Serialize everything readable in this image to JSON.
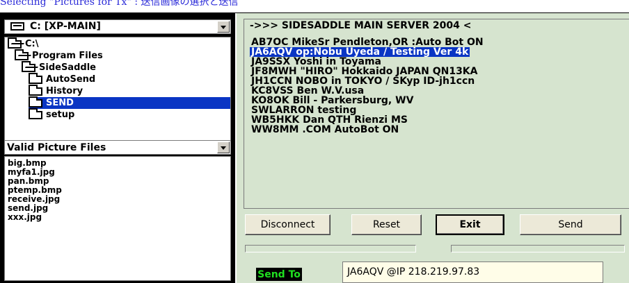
{
  "caption": "Selecting \"Pictures for Tx\"    :  送信画像の選択と送信",
  "drive": {
    "label": "C: [XP-MAIN]"
  },
  "tree": {
    "items": [
      {
        "label": "C:\\",
        "depth": 0,
        "icon": "folder-open-icon",
        "selected": false
      },
      {
        "label": "Program Files",
        "depth": 1,
        "icon": "folder-open-icon",
        "selected": false
      },
      {
        "label": "SideSaddle",
        "depth": 2,
        "icon": "folder-open-icon",
        "selected": false
      },
      {
        "label": "AutoSend",
        "depth": 3,
        "icon": "folder-icon",
        "selected": false
      },
      {
        "label": "History",
        "depth": 3,
        "icon": "folder-icon",
        "selected": false
      },
      {
        "label": "SEND",
        "depth": 3,
        "icon": "folder-icon",
        "selected": true
      },
      {
        "label": "setup",
        "depth": 3,
        "icon": "folder-icon",
        "selected": false
      }
    ]
  },
  "filter": {
    "label": "Valid Picture Files"
  },
  "files": [
    "big.bmp",
    "myfa1.jpg",
    "pan.bmp",
    "ptemp.bmp",
    "receive.jpg",
    "send.jpg",
    "xxx.jpg"
  ],
  "server": {
    "header": "->>>   SIDESADDLE MAIN SERVER 2004  <",
    "rows": [
      {
        "text": "AB7OC MikeSr  Pendleton,OR :Auto Bot ON",
        "selected": false
      },
      {
        "text": "JA6AQV op:Nobu Uyeda / Testing  Ver 4k",
        "selected": true
      },
      {
        "text": "JA9SSX Yoshi in Toyama",
        "selected": false
      },
      {
        "text": "JF8MWH \"HIRO\" Hokkaido JAPAN  QN13KA",
        "selected": false
      },
      {
        "text": "JH1CCN NOBO in TOKYO / SKyp ID-jh1ccn",
        "selected": false
      },
      {
        "text": "KC8VSS Ben W.V.usa",
        "selected": false
      },
      {
        "text": "KO8OK Bill - Parkersburg, WV",
        "selected": false
      },
      {
        "text": "SWLARRON testing",
        "selected": false
      },
      {
        "text": "WB5HKK Dan QTH Rienzi MS",
        "selected": false
      },
      {
        "text": "WW8MM .COM    AutoBot ON",
        "selected": false
      }
    ]
  },
  "buttons": {
    "disconnect": "Disconnect",
    "reset": "Reset",
    "exit": "Exit",
    "send": "Send"
  },
  "send_to": {
    "label": "Send To",
    "value": "JA6AQV @IP 218.219.97.83"
  },
  "colors": {
    "selection": "#0a35c4",
    "panel_bg": "#d6e4cf",
    "send_to_text": "#20e020"
  }
}
